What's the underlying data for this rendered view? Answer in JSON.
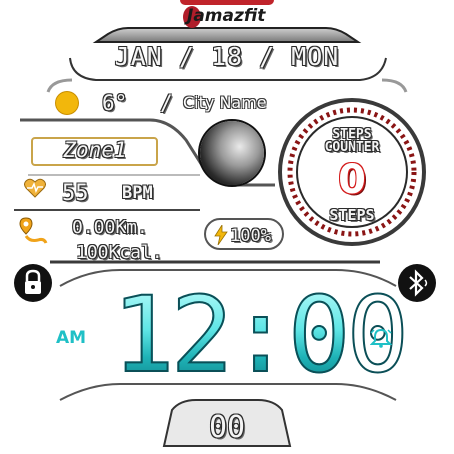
{
  "brand": {
    "logo_text": "Jamazfit"
  },
  "date": {
    "text": "JAN / 18 / MON"
  },
  "weather": {
    "icon": "sun-icon",
    "temperature": "6°",
    "separator": "/",
    "city": "City Name"
  },
  "zone": {
    "text": "Zone1"
  },
  "heart": {
    "icon": "heart-rate-icon",
    "value": "55",
    "unit": "BPM"
  },
  "activity": {
    "icon": "route-icon",
    "distance": "0.00Km.",
    "calories": "100Kcal."
  },
  "battery": {
    "icon": "lightning-icon",
    "value": "100%"
  },
  "moon": {
    "icon": "moon-phase-icon"
  },
  "steps": {
    "title_line1": "STEPS",
    "title_line2": "COUNTER",
    "value": "0",
    "label": "STEPS"
  },
  "lock": {
    "icon": "lock-icon"
  },
  "bluetooth": {
    "icon": "bluetooth-icon"
  },
  "time": {
    "display": "12:00",
    "ampm": "AM",
    "alarm_icon": "alarm-bell-icon"
  },
  "seconds": {
    "value": "00"
  },
  "colors": {
    "accent_cyan": "#1fc0c6",
    "steps_red": "#d41b1b",
    "zone_border": "#c9a44a",
    "sun": "#f2b70c"
  }
}
